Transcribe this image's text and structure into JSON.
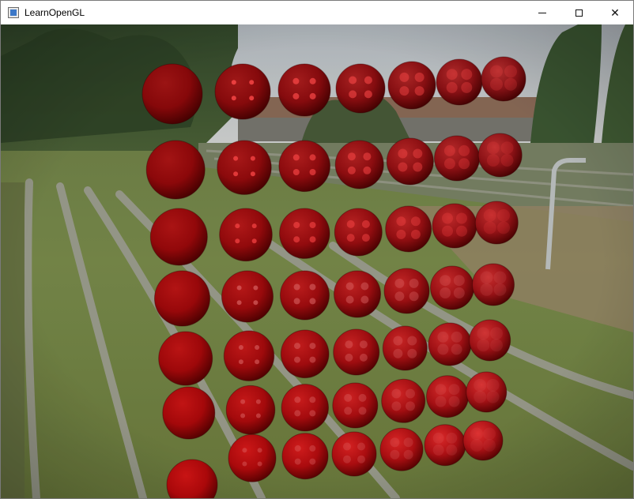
{
  "window": {
    "title": "LearnOpenGL",
    "icon": "opengl-app-icon",
    "controls": {
      "minimize": "minimize-icon",
      "maximize": "maximize-icon",
      "close": "close-icon"
    }
  },
  "scene": {
    "description_type": "PBR sphere grid rendered over skybox",
    "rows": 7,
    "columns": 7,
    "albedo_color": "#a00000",
    "background_colors": {
      "sky": "#c8ccd0",
      "trees": "#3f5a34",
      "grass": "#7d8f52",
      "steps": "#9a9a8e",
      "pole": "#bfc3c4"
    }
  }
}
